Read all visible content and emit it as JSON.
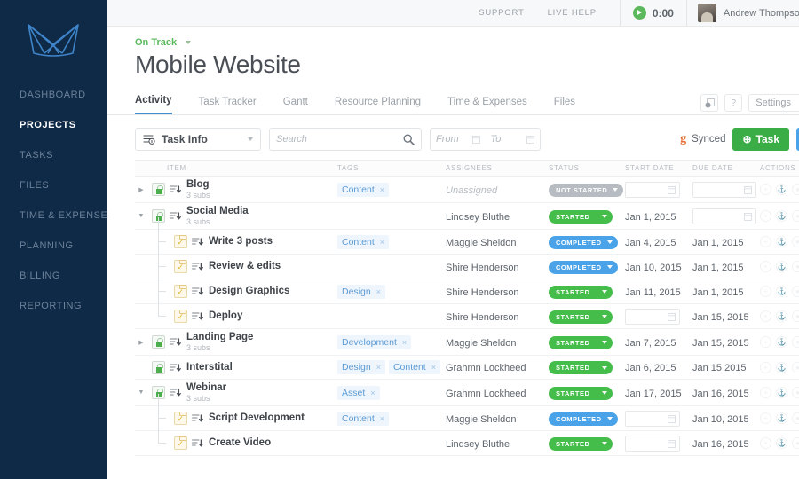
{
  "sidebar": {
    "logo_name": "brand-logo",
    "items": [
      {
        "label": "DASHBOARD",
        "active": false
      },
      {
        "label": "PROJECTS",
        "active": true
      },
      {
        "label": "TASKS",
        "active": false
      },
      {
        "label": "FILES",
        "active": false
      },
      {
        "label": "TIME & EXPENSE",
        "active": false
      },
      {
        "label": "PLANNING",
        "active": false
      },
      {
        "label": "BILLING",
        "active": false
      },
      {
        "label": "REPORTING",
        "active": false
      }
    ]
  },
  "topbar": {
    "support": "SUPPORT",
    "live_help": "LIVE HELP",
    "timer_value": "0:00",
    "user_name": "Andrew Thompson"
  },
  "project": {
    "status_label": "On Track",
    "title": "Mobile Website"
  },
  "tabs": [
    {
      "label": "Activity",
      "active": true
    },
    {
      "label": "Task Tracker",
      "active": false
    },
    {
      "label": "Gantt",
      "active": false
    },
    {
      "label": "Resource Planning",
      "active": false
    },
    {
      "label": "Time  & Expenses",
      "active": false
    },
    {
      "label": "Files",
      "active": false
    }
  ],
  "tab_actions": {
    "settings_label": "Settings",
    "help_glyph": "?"
  },
  "toolbar": {
    "task_info_label": "Task Info",
    "search_placeholder": "Search",
    "from_placeholder": "From",
    "to_placeholder": "To",
    "synced_label": "Synced",
    "synced_icon": "g",
    "add_task_label": "Task",
    "add_task_glyph": "⊕"
  },
  "columns": {
    "item": "ITEM",
    "tags": "TAGS",
    "assignees": "ASSIGNEES",
    "status": "STATUS",
    "start_date": "START DATE",
    "due_date": "DUE DATE",
    "actions": "ACTIONS"
  },
  "colors": {
    "sidebar_bg": "#0e2a47",
    "accent_blue": "#3e8ed0",
    "status_started": "#45bd4a",
    "status_completed": "#4aa3e8",
    "status_not_started": "#b6bcc2",
    "tag_bg": "#eef5fc",
    "tag_text": "#5b9bd5",
    "button_green": "#3aad46",
    "ontrack_green": "#5cb85c",
    "synced_orange": "#e8703a"
  },
  "rows": [
    {
      "name": "Blog",
      "subs": "3 subs",
      "level": 0,
      "kind": "folder",
      "expander": "collapsed",
      "tags": [
        "Content"
      ],
      "assignee": "Unassigned",
      "unassigned": true,
      "status": "NOT STARTED",
      "status_kind": "notstarted",
      "start_date": "",
      "due_date": ""
    },
    {
      "name": "Social Media",
      "subs": "3 subs",
      "level": 0,
      "kind": "folder",
      "expander": "expanded",
      "tags": [],
      "assignee": "Lindsey Bluthe",
      "unassigned": false,
      "status": "STARTED",
      "status_kind": "started",
      "start_date": "Jan 1, 2015",
      "due_date": ""
    },
    {
      "name": "Write 3 posts",
      "subs": "",
      "level": 1,
      "kind": "check",
      "expander": "",
      "tags": [
        "Content"
      ],
      "assignee": "Maggie Sheldon",
      "unassigned": false,
      "status": "COMPLETED",
      "status_kind": "completed",
      "start_date": "Jan 4, 2015",
      "due_date": "Jan 1, 2015"
    },
    {
      "name": "Review & edits",
      "subs": "",
      "level": 1,
      "kind": "check",
      "expander": "",
      "tags": [],
      "assignee": "Shire Henderson",
      "unassigned": false,
      "status": "COMPLETED",
      "status_kind": "completed",
      "start_date": "Jan 10, 2015",
      "due_date": "Jan 1, 2015"
    },
    {
      "name": "Design Graphics",
      "subs": "",
      "level": 1,
      "kind": "check",
      "expander": "",
      "tags": [
        "Design"
      ],
      "assignee": "Shire Henderson",
      "unassigned": false,
      "status": "STARTED",
      "status_kind": "started",
      "start_date": "Jan 11, 2015",
      "due_date": "Jan 1, 2015"
    },
    {
      "name": "Deploy",
      "subs": "",
      "level": 1,
      "kind": "check",
      "expander": "",
      "tags": [],
      "assignee": "Shire Henderson",
      "unassigned": false,
      "status": "STARTED",
      "status_kind": "started",
      "start_date": "",
      "due_date": "Jan 15, 2015"
    },
    {
      "name": "Landing Page",
      "subs": "3 subs",
      "level": 0,
      "kind": "folder",
      "expander": "collapsed",
      "tags": [
        "Development"
      ],
      "assignee": "Maggie Sheldon",
      "unassigned": false,
      "status": "STARTED",
      "status_kind": "started",
      "start_date": "Jan 7, 2015",
      "due_date": "Jan 15, 2015"
    },
    {
      "name": "Interstital",
      "subs": "",
      "level": 0,
      "kind": "folder",
      "expander": "none",
      "tags": [
        "Design",
        "Content"
      ],
      "assignee": "Grahmn Lockheed",
      "unassigned": false,
      "status": "STARTED",
      "status_kind": "started",
      "start_date": "Jan 6, 2015",
      "due_date": "Jan 15 2015"
    },
    {
      "name": "Webinar",
      "subs": "3 subs",
      "level": 0,
      "kind": "folder",
      "expander": "expanded",
      "tags": [
        "Asset"
      ],
      "assignee": "Grahmn Lockheed",
      "unassigned": false,
      "status": "STARTED",
      "status_kind": "started",
      "start_date": "Jan 17, 2015",
      "due_date": "Jan 16, 2015"
    },
    {
      "name": "Script Development",
      "subs": "",
      "level": 1,
      "kind": "check",
      "expander": "",
      "tags": [
        "Content"
      ],
      "assignee": "Maggie Sheldon",
      "unassigned": false,
      "status": "COMPLETED",
      "status_kind": "completed",
      "start_date": "",
      "due_date": "Jan 10, 2015"
    },
    {
      "name": "Create Video",
      "subs": "",
      "level": 1,
      "kind": "check",
      "expander": "",
      "tags": [],
      "assignee": "Lindsey Bluthe",
      "unassigned": false,
      "status": "STARTED",
      "status_kind": "started",
      "start_date": "",
      "due_date": "Jan 16, 2015"
    }
  ]
}
